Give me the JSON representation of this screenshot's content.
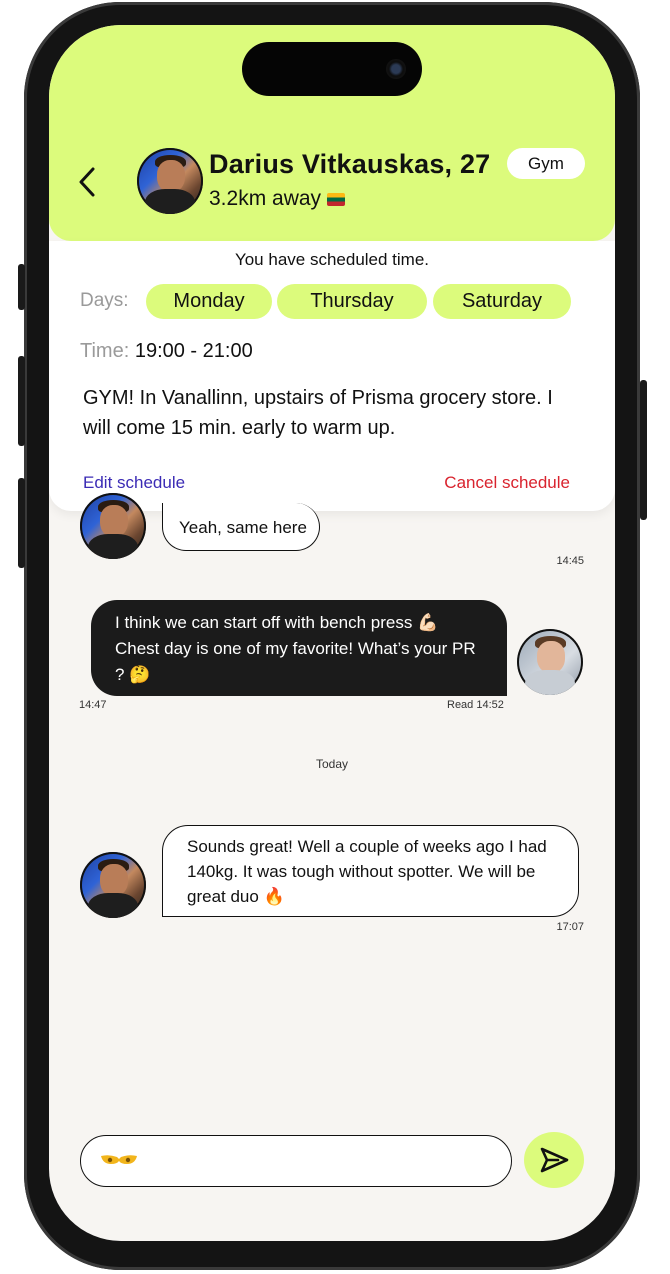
{
  "header": {
    "name": "Darius Vitkauskas, 27",
    "distance": "3.2km away",
    "tag": "Gym"
  },
  "schedule": {
    "title": "You have scheduled time.",
    "days_label": "Days:",
    "days": [
      "Monday",
      "Thursday",
      "Saturday"
    ],
    "time_label": "Time:",
    "time_value": "19:00 - 21:00",
    "note": "GYM! In Vanallinn, upstairs of  Prisma grocery store. I will come 15 min. early to warm up.",
    "edit_label": "Edit schedule",
    "cancel_label": "Cancel schedule"
  },
  "messages": [
    {
      "from": "them",
      "text": "Yeah, same here",
      "time": "14:45"
    },
    {
      "from": "me",
      "text": "I think we can start off with bench press 💪🏻 Chest day is one of my favorite! What’s your PR ? 🤔",
      "time": "14:47",
      "status": "Read 14:52"
    },
    {
      "from": "them",
      "text": "Sounds great! Well a couple of weeks ago I had 140kg. It was tough without spotter. We will be great duo 🔥",
      "time": "17:07"
    }
  ],
  "divider": "Today",
  "composer": {
    "value": "",
    "placeholder": ""
  },
  "colors": {
    "accent": "#dcfb7c",
    "edit": "#3b2bb5",
    "cancel": "#d9232e",
    "dark_bubble": "#1b1b1b"
  },
  "icons": {
    "back": "chevron-left-icon",
    "emoji": "emoji-icon",
    "send": "send-icon",
    "flag": "lithuania-flag-icon"
  }
}
